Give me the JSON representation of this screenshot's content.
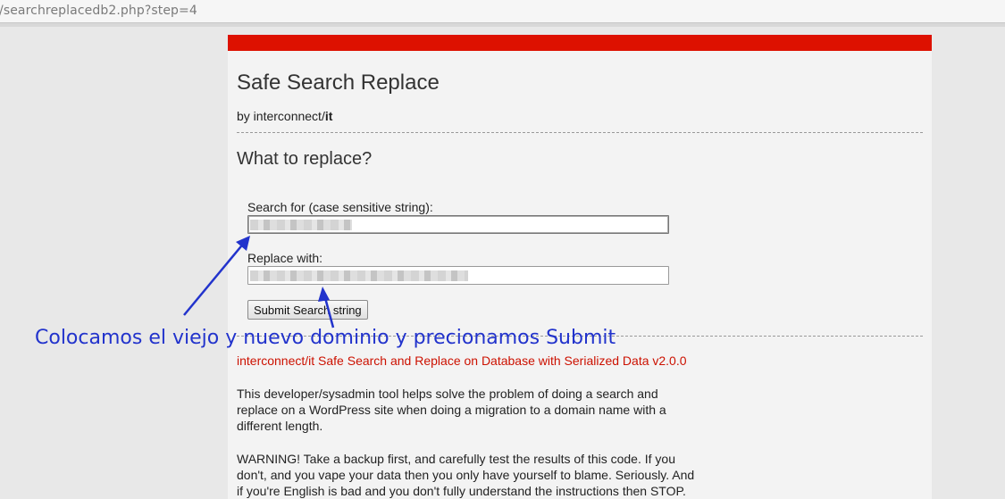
{
  "browser": {
    "url": "/searchreplacedb2.php?step=4"
  },
  "header": {
    "title": "Safe Search Replace",
    "byline_prefix": "by interconnect/",
    "byline_bold": "it"
  },
  "form": {
    "heading": "What to replace?",
    "search_label": "Search for (case sensitive string):",
    "replace_label": "Replace with:",
    "submit_label": "Submit Search string"
  },
  "info": {
    "subtitle": "interconnect/it Safe Search and Replace on Database with Serialized Data v2.0.0",
    "paragraph1": "This developer/sysadmin tool helps solve the problem of doing a search and replace on a WordPress site when doing a migration to a domain name with a different length.",
    "paragraph2": "WARNING! Take a backup first, and carefully test the results of this code. If you don't, and you vape your data then you only have yourself to blame. Seriously. And if you're English is bad and you don't fully understand the instructions then STOP."
  },
  "annotation": {
    "text": "Colocamos el viejo y nuevo dominio y precionamos Submit",
    "color": "#2233cc"
  },
  "colors": {
    "accent": "#dd1100"
  }
}
